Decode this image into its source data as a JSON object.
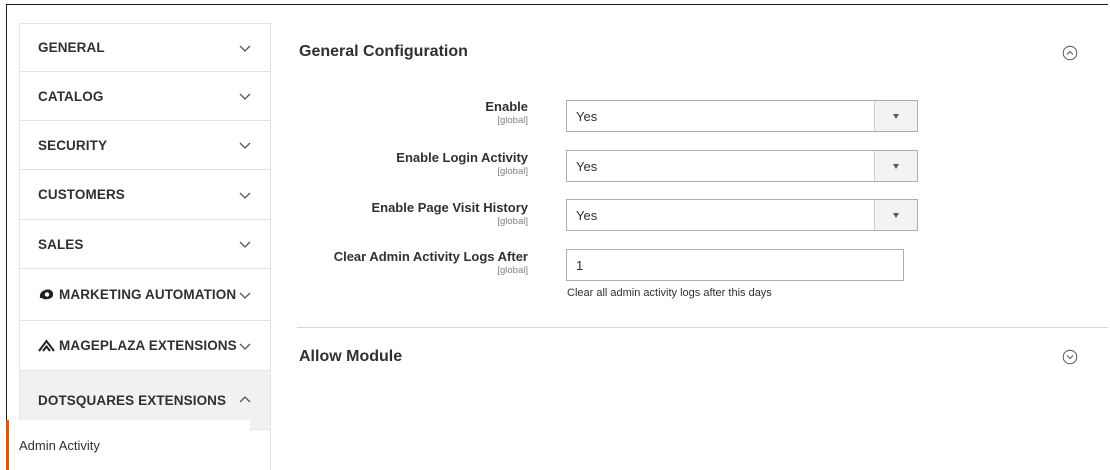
{
  "sidebar": {
    "items": [
      {
        "label": "GENERAL"
      },
      {
        "label": "CATALOG"
      },
      {
        "label": "SECURITY"
      },
      {
        "label": "CUSTOMERS"
      },
      {
        "label": "SALES"
      },
      {
        "label": "MARKETING AUTOMATION",
        "icon": "marketing-automation-icon"
      },
      {
        "label": "MAGEPLAZA EXTENSIONS",
        "icon": "mageplaza-icon"
      },
      {
        "label": "DOTSQUARES EXTENSIONS"
      }
    ],
    "sub_item": "Admin Activity"
  },
  "general_section": {
    "title": "General Configuration",
    "fields": [
      {
        "label": "Enable",
        "scope": "[global]",
        "value": "Yes"
      },
      {
        "label": "Enable Login Activity",
        "scope": "[global]",
        "value": "Yes"
      },
      {
        "label": "Enable Page Visit History",
        "scope": "[global]",
        "value": "Yes"
      },
      {
        "label": "Clear Admin Activity Logs After",
        "scope": "[global]",
        "value": "1",
        "note": "Clear all admin activity logs after this days"
      }
    ]
  },
  "allow_section": {
    "title": "Allow Module"
  },
  "colors": {
    "accent": "#eb5202",
    "text": "#303030",
    "border": "#adadad"
  }
}
